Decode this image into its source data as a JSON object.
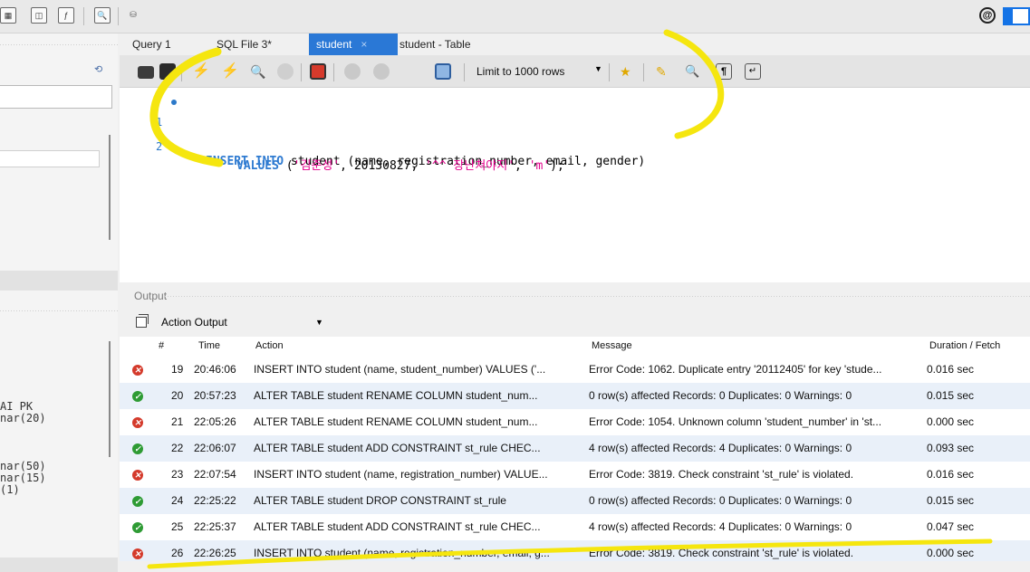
{
  "editor": {
    "tabs": [
      {
        "label": "Query 1"
      },
      {
        "label": "SQL File 3*"
      },
      {
        "label": "student",
        "close": "×"
      },
      {
        "label": "student - Table"
      }
    ],
    "limit_label": "Limit to 1000 rows",
    "code": {
      "line1_no": "1",
      "line1_kw1": "INSERT INTO",
      "line1_rest": " student (name, registration_number, email, gender)",
      "line2_no": "2",
      "line2_kw": "VALUES",
      "line2_open": " (",
      "line2_s1": "'김준성'",
      "line2_c1": ", 20130827, ",
      "line2_s2": "'^^ 장난쳐야지'",
      "line2_c2": ", ",
      "line2_s3": "'m'",
      "line2_close": ");"
    }
  },
  "left_pane": {
    "fragments": [
      "AI PK",
      "nar(20)",
      "nar(50)",
      "nar(15)",
      "(1)"
    ]
  },
  "output": {
    "title": "Output",
    "select_label": "Action Output",
    "columns": {
      "num": "#",
      "time": "Time",
      "action": "Action",
      "message": "Message",
      "duration": "Duration / Fetch"
    },
    "rows": [
      {
        "status": "error",
        "num": "19",
        "time": "20:46:06",
        "action": "INSERT INTO student (name, student_number) VALUES ('...",
        "message": "Error Code: 1062. Duplicate entry '20112405' for key 'stude...",
        "duration": "0.016 sec"
      },
      {
        "status": "ok",
        "num": "20",
        "time": "20:57:23",
        "action": "ALTER TABLE student  RENAME COLUMN student_num...",
        "message": "0 row(s) affected Records: 0  Duplicates: 0  Warnings: 0",
        "duration": "0.015 sec"
      },
      {
        "status": "error",
        "num": "21",
        "time": "22:05:26",
        "action": "ALTER TABLE student  RENAME COLUMN student_num...",
        "message": "Error Code: 1054. Unknown column 'student_number' in 'st...",
        "duration": "0.000 sec"
      },
      {
        "status": "ok",
        "num": "22",
        "time": "22:06:07",
        "action": "ALTER TABLE student ADD CONSTRAINT st_rule CHEC...",
        "message": "4 row(s) affected Records: 4  Duplicates: 0  Warnings: 0",
        "duration": "0.093 sec"
      },
      {
        "status": "error",
        "num": "23",
        "time": "22:07:54",
        "action": "INSERT INTO student (name, registration_number) VALUE...",
        "message": "Error Code: 3819. Check constraint 'st_rule' is violated.",
        "duration": "0.016 sec"
      },
      {
        "status": "ok",
        "num": "24",
        "time": "22:25:22",
        "action": "ALTER TABLE student DROP CONSTRAINT st_rule",
        "message": "0 row(s) affected Records: 0  Duplicates: 0  Warnings: 0",
        "duration": "0.015 sec"
      },
      {
        "status": "ok",
        "num": "25",
        "time": "22:25:37",
        "action": "ALTER TABLE student ADD CONSTRAINT st_rule CHEC...",
        "message": "4 row(s) affected Records: 4  Duplicates: 0  Warnings: 0",
        "duration": "0.047 sec"
      },
      {
        "status": "error",
        "num": "26",
        "time": "22:26:25",
        "action": "INSERT INTO student (name, registration_number, email, g...",
        "message": "Error Code: 3819. Check constraint 'st_rule' is violated.",
        "duration": "0.000 sec"
      }
    ]
  },
  "colors": {
    "accent": "#2a78d6",
    "annotation": "#f5e60f",
    "error": "#d43a2b",
    "success": "#2e9b34"
  }
}
